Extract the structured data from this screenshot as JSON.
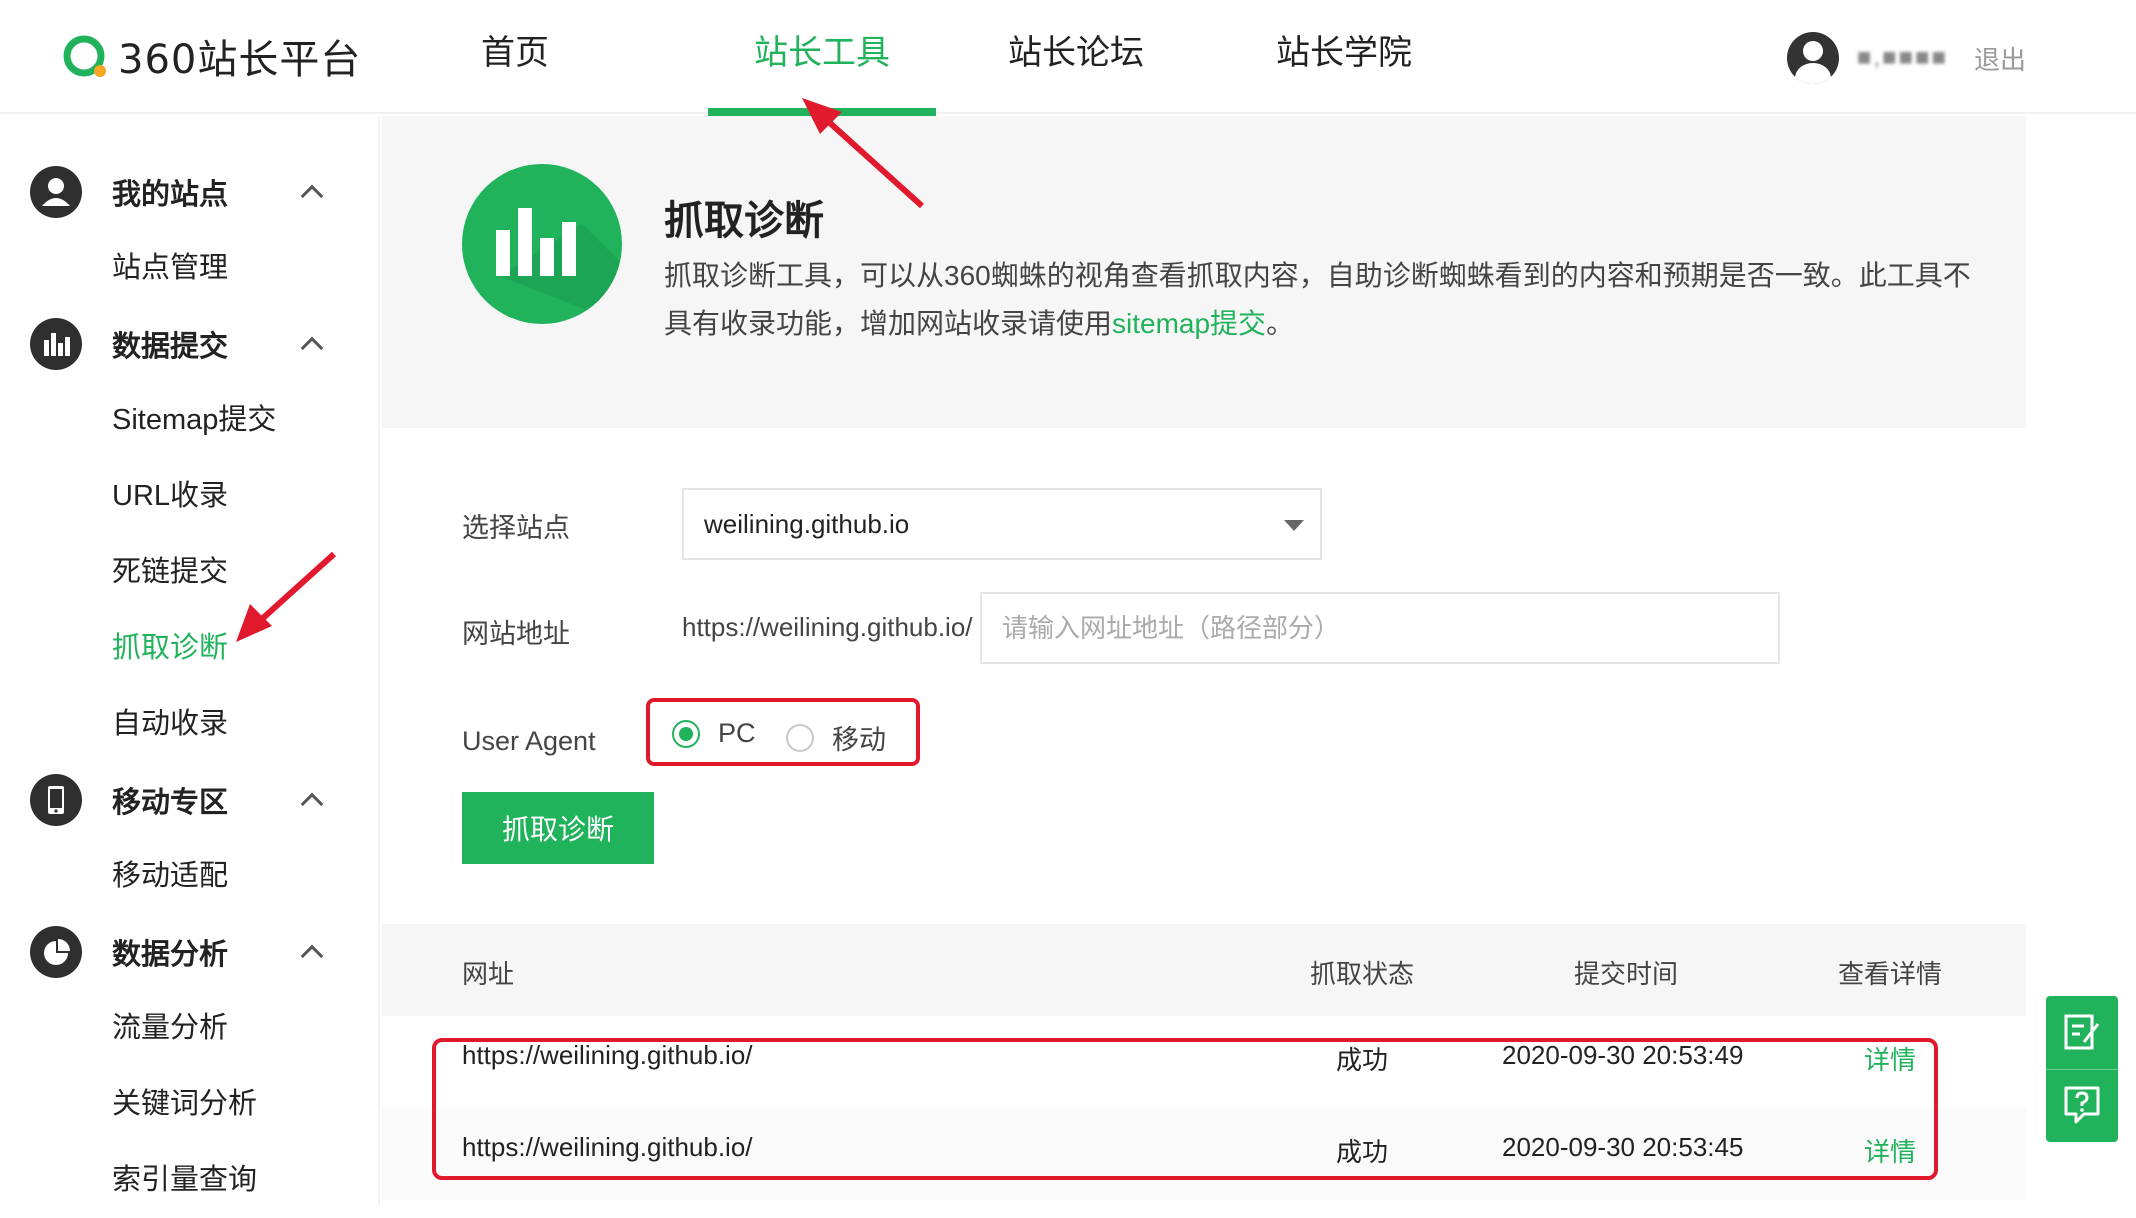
{
  "brand": {
    "name": "360站长平台",
    "accent": "#21b25c"
  },
  "nav": {
    "items": [
      {
        "label": "首页"
      },
      {
        "label": "站长工具"
      },
      {
        "label": "站长论坛"
      },
      {
        "label": "站长学院"
      }
    ],
    "active": "站长工具"
  },
  "user": {
    "name": "■,■■■■",
    "logout": "退出"
  },
  "sidebar": {
    "groups": [
      {
        "title": "我的站点",
        "icon": "user-icon",
        "items": [
          "站点管理"
        ]
      },
      {
        "title": "数据提交",
        "icon": "bar-chart-icon",
        "items": [
          "Sitemap提交",
          "URL收录",
          "死链提交",
          "抓取诊断",
          "自动收录"
        ]
      },
      {
        "title": "移动专区",
        "icon": "mobile-icon",
        "items": [
          "移动适配"
        ]
      },
      {
        "title": "数据分析",
        "icon": "pie-chart-icon",
        "items": [
          "流量分析",
          "关键词分析",
          "索引量查询"
        ]
      }
    ],
    "active_item": "抓取诊断"
  },
  "intro": {
    "title": "抓取诊断",
    "desc_part1": "抓取诊断工具，可以从360蜘蛛的视角查看抓取内容，自助诊断蜘蛛看到的内容和预期是否一致。此工具不具有收录功能，增加网站收录请使用",
    "desc_link": "sitemap提交",
    "desc_part2": "。"
  },
  "form": {
    "site_label": "选择站点",
    "site_value": "weilining.github.io",
    "url_label": "网站地址",
    "url_prefix": "https://weilining.github.io/",
    "url_placeholder": "请输入网址地址（路径部分）",
    "ua_label": "User Agent",
    "ua_options": [
      "PC",
      "移动"
    ],
    "ua_selected": "PC",
    "submit_label": "抓取诊断"
  },
  "table": {
    "headers": [
      "网址",
      "抓取状态",
      "提交时间",
      "查看详情"
    ],
    "rows": [
      {
        "url": "https://weilining.github.io/",
        "status": "成功",
        "time": "2020-09-30 20:53:49",
        "detail": "详情"
      },
      {
        "url": "https://weilining.github.io/",
        "status": "成功",
        "time": "2020-09-30 20:53:45",
        "detail": "详情"
      }
    ]
  },
  "float_tools": [
    "edit-icon",
    "help-icon"
  ],
  "annotation_color": "#e0192d"
}
